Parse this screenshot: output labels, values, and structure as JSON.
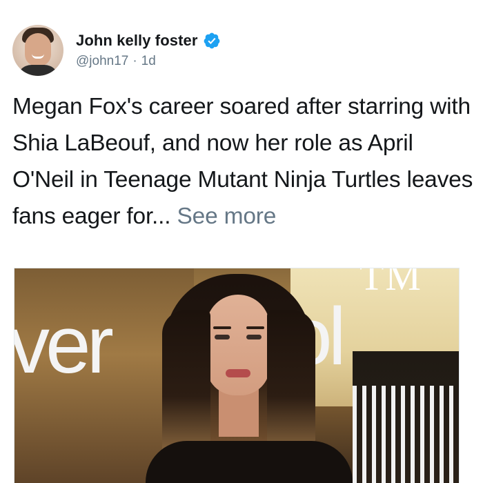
{
  "user": {
    "display_name": "John kelly foster",
    "handle": "@john17",
    "separator": "·",
    "timestamp": "1d",
    "verified": true
  },
  "tweet": {
    "text": "Megan Fox's career soared after starring with Shia LaBeouf, and now her role as April O'Neil in Teenage Mutant Ninja Turtles leaves fans eager for...",
    "see_more_label": "See more"
  },
  "media": {
    "backdrop_text_left": "ver",
    "backdrop_text_right": "ol",
    "backdrop_text_top": "TM"
  },
  "colors": {
    "verified": "#1da1f2",
    "secondary_text": "#657786",
    "primary_text": "#14171a"
  },
  "icons": {
    "verified": "verified-badge-icon"
  }
}
